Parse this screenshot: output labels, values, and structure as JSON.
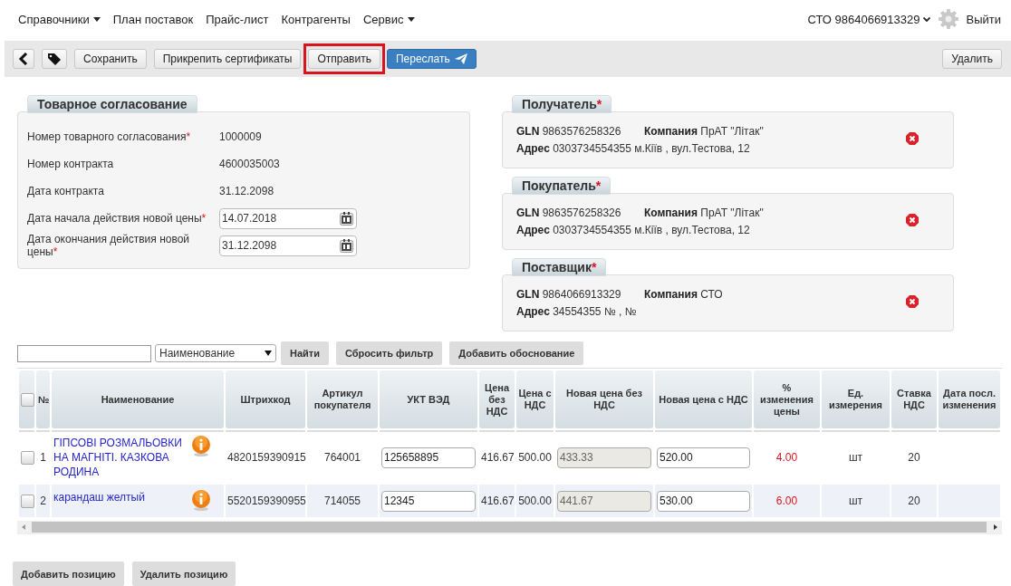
{
  "nav": {
    "items": [
      {
        "label": "Справочники",
        "dropdown": true
      },
      {
        "label": "План поставок",
        "dropdown": false
      },
      {
        "label": "Прайс-лист",
        "dropdown": false
      },
      {
        "label": "Контрагенты",
        "dropdown": false
      },
      {
        "label": "Сервис",
        "dropdown": true
      }
    ],
    "account": "СТО 9864066913329",
    "logout": "Выйти"
  },
  "required_mark": "*",
  "toolbar": {
    "buttons": [
      {
        "kind": "back",
        "highlighted": false
      },
      {
        "kind": "tag",
        "highlighted": false
      },
      {
        "kind": "plain",
        "label": "Сохранить",
        "highlighted": false
      },
      {
        "kind": "plain",
        "label": "Прикрепить сертификаты",
        "highlighted": false
      },
      {
        "kind": "plain",
        "label": "Отправить",
        "highlighted": true
      },
      {
        "kind": "primary",
        "label": "Переслать",
        "highlighted": false
      }
    ],
    "right_button": "Удалить"
  },
  "agreement": {
    "title": "Товарное согласование",
    "fields": [
      {
        "kind": "text",
        "label": "Номер товарного согласования",
        "required": true,
        "value": "1000009"
      },
      {
        "kind": "text",
        "label": "Номер контракта",
        "required": false,
        "value": "4600035003"
      },
      {
        "kind": "text",
        "label": "Дата контракта",
        "required": false,
        "value": "31.12.2098"
      },
      {
        "kind": "date",
        "label": "Дата начала действия новой цены",
        "required": true,
        "value": "14.07.2018"
      },
      {
        "kind": "date",
        "label": "Дата окончания действия новой цены",
        "required": true,
        "value": "31.12.2098"
      }
    ]
  },
  "parties": [
    {
      "title": "Получатель",
      "required": true,
      "gln_label": "GLN",
      "gln": "9863576258326",
      "company_label": "Компания",
      "company": "ПрАТ \"Літак\"",
      "address_label": "Адрес",
      "address": "0303734554355 м.Кіїв , вул.Тестова, 12"
    },
    {
      "title": "Покупатель",
      "required": true,
      "gln_label": "GLN",
      "gln": "9863576258326",
      "company_label": "Компания",
      "company": "ПрАТ \"Літак\"",
      "address_label": "Адрес",
      "address": "0303734554355 м.Кіїв , вул.Тестова, 12"
    },
    {
      "title": "Поставщик",
      "required": true,
      "gln_label": "GLN",
      "gln": "9864066913329",
      "company_label": "Компания",
      "company": "СТО",
      "address_label": "Адрес",
      "address": "34554355 № , №"
    }
  ],
  "filter": {
    "select": "Наименование",
    "buttons": [
      "Найти",
      "Сбросить фильтр",
      "Добавить обоснование"
    ]
  },
  "table": {
    "select_all_checked": false,
    "columns": [
      "№",
      "Наименование",
      "Штрихкод",
      "Артикул покупателя",
      "УКТ ВЭД",
      "Цена без НДС",
      "Цена с НДС",
      "Новая цена без НДС",
      "Новая цена с НДС",
      "% изменения цены",
      "Ед. измерения",
      "Ставка НДС",
      "Дата посл. изменения"
    ],
    "rows": [
      {
        "checked": false,
        "number": "1",
        "name": "ГІПСОВІ РОЗМАЛЬОВКИ НА МАГНІТІ. КАЗКОВА РОДИНА",
        "barcode": "4820159390915",
        "article": "764001",
        "ukt": "125658895",
        "price_net": "416.67",
        "price_gross": "500.00",
        "new_net": "433.33",
        "new_net_disabled": true,
        "new_gross": "520.00",
        "change": "4.00",
        "unit": "шт",
        "vat": "20"
      },
      {
        "checked": false,
        "number": "2",
        "name": "карандаш желтый",
        "barcode": "5520159390955",
        "article": "714055",
        "ukt": "12345",
        "price_net": "416.67",
        "price_gross": "500.00",
        "new_net": "441.67",
        "new_net_disabled": true,
        "new_gross": "530.00",
        "change": "6.00",
        "unit": "шт",
        "vat": "20"
      }
    ]
  },
  "bottom_buttons": [
    "Добавить позицию",
    "Удалить позицию"
  ]
}
